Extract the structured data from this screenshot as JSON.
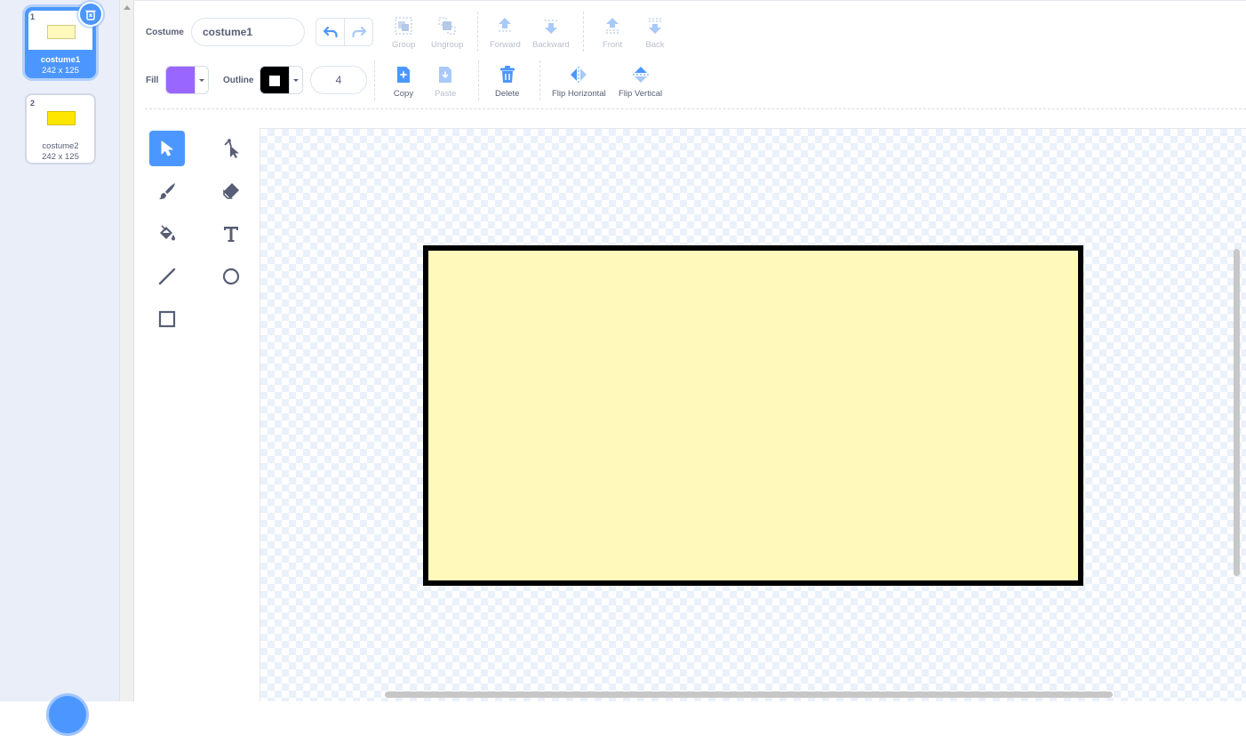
{
  "costumes": [
    {
      "index": "1",
      "name": "costume1",
      "size": "242 x 125",
      "selected": true,
      "thumb_color": "#fff9bc"
    },
    {
      "index": "2",
      "name": "costume2",
      "size": "242 x 125",
      "selected": false,
      "thumb_color": "#ffe600"
    }
  ],
  "toolbar": {
    "costume_label": "Costume",
    "costume_name": "costume1",
    "group_label": "Group",
    "ungroup_label": "Ungroup",
    "forward_label": "Forward",
    "backward_label": "Backward",
    "front_label": "Front",
    "back_label": "Back",
    "fill_label": "Fill",
    "fill_color": "#9966ff",
    "outline_label": "Outline",
    "outline_color": "#000000",
    "outline_width": "4",
    "copy_label": "Copy",
    "paste_label": "Paste",
    "delete_label": "Delete",
    "flip_horizontal_label": "Flip Horizontal",
    "flip_vertical_label": "Flip Vertical"
  },
  "tools": [
    {
      "id": "select",
      "icon": "select-arrow-icon",
      "active": true
    },
    {
      "id": "reshape",
      "icon": "reshape-icon",
      "active": false
    },
    {
      "id": "brush",
      "icon": "brush-icon",
      "active": false
    },
    {
      "id": "eraser",
      "icon": "eraser-icon",
      "active": false
    },
    {
      "id": "fill",
      "icon": "fill-bucket-icon",
      "active": false
    },
    {
      "id": "text",
      "icon": "text-icon",
      "active": false
    },
    {
      "id": "line",
      "icon": "line-icon",
      "active": false
    },
    {
      "id": "circle",
      "icon": "circle-icon",
      "active": false
    },
    {
      "id": "rectangle",
      "icon": "rectangle-icon",
      "active": false
    }
  ],
  "canvas": {
    "shape_fill": "#fff9bc",
    "shape_outline": "#000000"
  },
  "colors": {
    "accent": "#4c97ff",
    "text": "#575e75",
    "disabled": "#b8bfcc"
  }
}
